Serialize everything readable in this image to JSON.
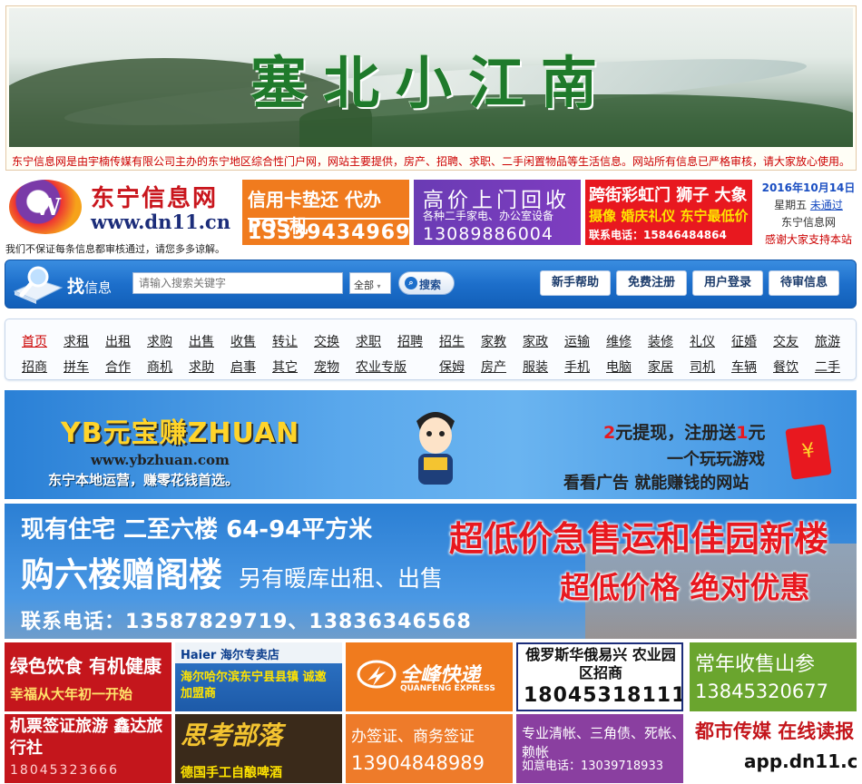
{
  "header": {
    "banner_title": "塞北小江南",
    "notice": "东宁信息网是由宇楠传媒有限公司主办的东宁地区综合性门户网，网站主要提供，房产、招聘、求职、二手闲置物品等生活信息。网站所有信息已严格审核，请大家放心使用。"
  },
  "logo": {
    "badge": "W",
    "name": "东宁信息网",
    "url": "www.dn11.cn",
    "disclaimer": "我们不保证每条信息都审核通过，请您多多谅解。"
  },
  "top_ads": [
    {
      "line1": "信用卡垫还 代办 POS机",
      "line2": "13339434969"
    },
    {
      "line1": "高价上门回收",
      "sub": "各种二手家电、办公室设备",
      "line2": "13089886004"
    },
    {
      "line1": "跨街彩虹门 狮子 大象",
      "sub": "摄像 婚庆礼仪 东宁最低价",
      "line2": "联系电话：15846484864"
    }
  ],
  "date_box": {
    "date": "2016年10月14日",
    "weekday": "星期五",
    "unpassed": "未通过",
    "site": "东宁信息网",
    "thanks": "感谢大家支持本站"
  },
  "search": {
    "title": "找",
    "title_rest": "信息",
    "placeholder": "请输入搜索关键字",
    "scope": "全部",
    "button": "搜索",
    "nav_buttons": [
      "新手帮助",
      "免费注册",
      "用户登录",
      "待审信息"
    ]
  },
  "categories": {
    "row1": [
      "首页",
      "求租",
      "出租",
      "求购",
      "出售",
      "收售",
      "转让",
      "交换",
      "求职",
      "招聘",
      "招生",
      "家教",
      "家政",
      "运输",
      "维修",
      "装修",
      "礼仪",
      "征婚",
      "交友",
      "旅游"
    ],
    "row2": [
      "招商",
      "拼车",
      "合作",
      "商机",
      "求助",
      "启事",
      "其它",
      "宠物",
      "农业专版",
      "保姆",
      "房产",
      "服装",
      "手机",
      "电脑",
      "家居",
      "司机",
      "车辆",
      "餐饮",
      "二手"
    ]
  },
  "ybz_ad": {
    "logo": "YB元宝赚ZHUAN",
    "url": "www.ybzhuan.com",
    "tagline": "东宁本地运营，赚零花钱首选。",
    "r1_pre": "2",
    "r1_mid": "元提现，注册送",
    "r1_num": "1",
    "r1_post": "元",
    "r2": "一个玩玩游戏",
    "r3": "看看广告 就能赚钱的网站",
    "envelope": "¥"
  },
  "house_ad": {
    "h1": "现有住宅 二至六楼 64-94平方米",
    "h2": "购六楼赠阁楼",
    "h2_sub": "另有暖库出租、出售",
    "phone": "联系电话：13587829719、13836346568",
    "big": "超低价急售运和佳园新楼",
    "big2": "超低价格 绝对优惠"
  },
  "tiles": [
    {
      "l1": "绿色饮食 有机健康",
      "l2": "幸福从大年初一开始"
    },
    {
      "l1": "Haier 海尔专卖店",
      "l2": "海尔哈尔滨东宁县县镇 诚邀加盟商"
    },
    {
      "l1": "全峰快递",
      "l2": "QUANFENG EXPRESS"
    },
    {
      "l1": "俄罗斯华俄易兴 农业园区招商",
      "l2": "18045318111"
    },
    {
      "l1": "常年收售山参",
      "l2": "13845320677"
    },
    {
      "l1": "机票签证旅游 鑫达旅行社",
      "l2": "18045323666"
    },
    {
      "l1": "思考部落",
      "l2": "德国手工自酿啤酒"
    },
    {
      "l1": "办签证、商务签证",
      "l2": "13904848989"
    },
    {
      "l1": "专业清帐、三角债、死帐、赖帐",
      "l2": "如意电话：13039718933"
    },
    {
      "l1": "都市传媒 在线读报",
      "l2": "app.dn11.cn"
    }
  ]
}
